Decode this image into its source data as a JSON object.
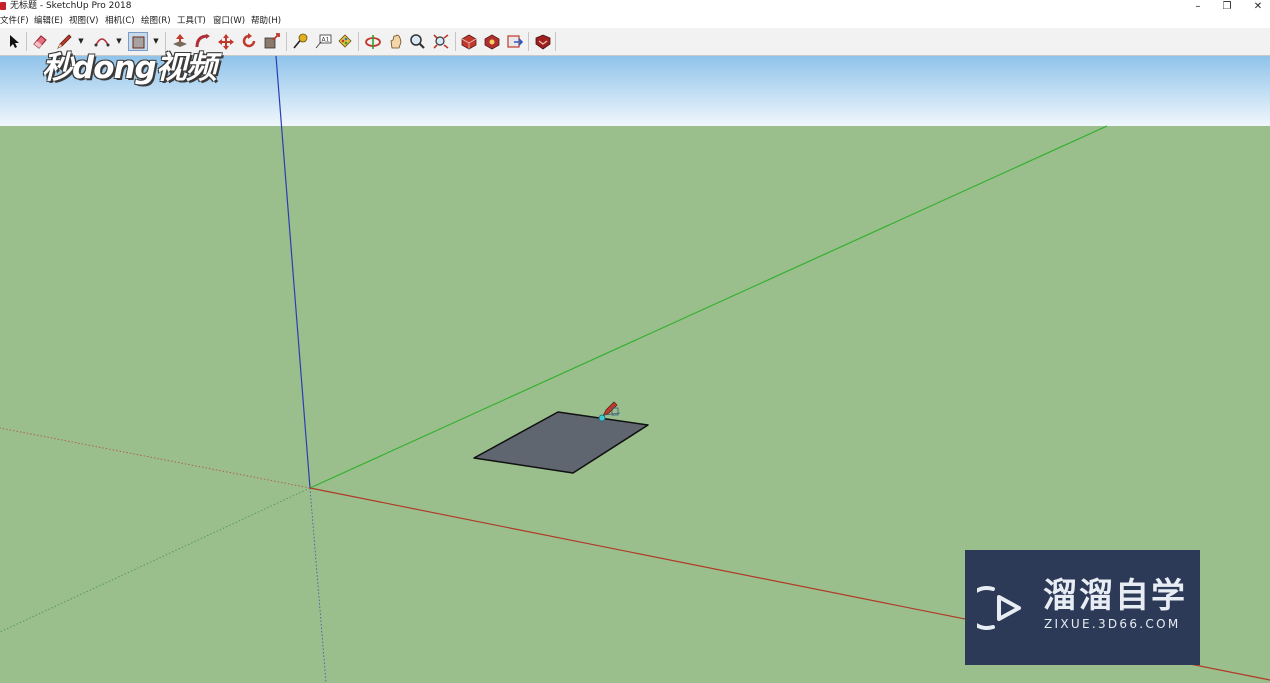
{
  "window": {
    "title": "无标题 - SketchUp Pro 2018",
    "controls": {
      "minimize": "–",
      "restore": "❐",
      "close": "✕"
    }
  },
  "menu": [
    {
      "label": "文件(F)"
    },
    {
      "label": "编辑(E)"
    },
    {
      "label": "视图(V)"
    },
    {
      "label": "相机(C)"
    },
    {
      "label": "绘图(R)"
    },
    {
      "label": "工具(T)"
    },
    {
      "label": "窗口(W)"
    },
    {
      "label": "帮助(H)"
    }
  ],
  "toolbar": {
    "tools": [
      "select-tool",
      "eraser-tool",
      "line-tool",
      "arc-tool",
      "rectangle-tool",
      "push-pull-tool",
      "follow-me-tool",
      "move-tool",
      "rotate-tool",
      "scale-tool",
      "tape-measure-tool",
      "text-tool",
      "paint-bucket-tool",
      "orbit-tool",
      "pan-tool",
      "zoom-tool",
      "zoom-extents-tool",
      "3d-warehouse-tool",
      "extension-warehouse-tool",
      "layout-send-tool",
      "extension-manager-tool"
    ],
    "active_tool": "rectangle-tool"
  },
  "scene": {
    "colors": {
      "sky_top": "#8fc3ea",
      "sky_bottom": "#f0f7fc",
      "ground": "#9bbf8c",
      "red_axis": "#b03a28",
      "green_axis": "#36b032",
      "blue_axis": "#2a3db5",
      "face": "#5f6670",
      "edge": "#111111"
    },
    "drawn_object": "rectangle-face",
    "cursor": "pencil-cursor"
  },
  "watermarks": {
    "top_left": "秒dong视频",
    "bottom_right": {
      "name": "溜溜自学",
      "url": "ZIXUE.3D66.COM"
    }
  }
}
